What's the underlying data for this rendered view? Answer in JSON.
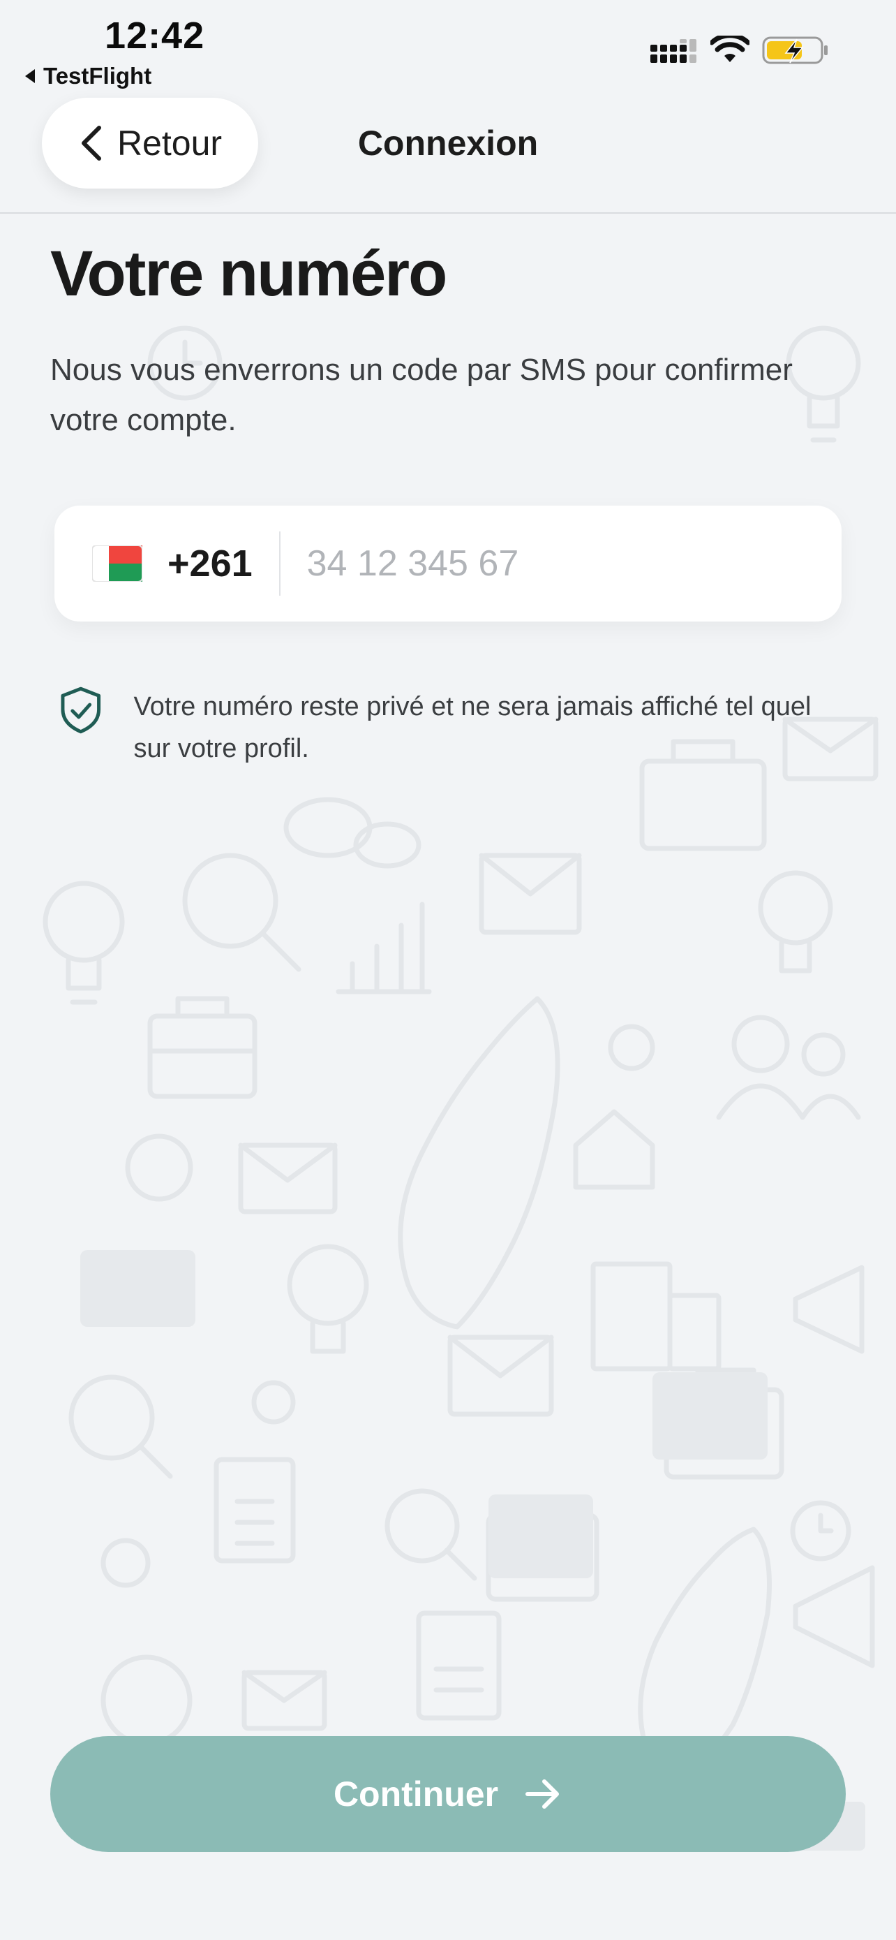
{
  "status_bar": {
    "time": "12:42",
    "back_app": "TestFlight"
  },
  "nav": {
    "back_label": "Retour",
    "title": "Connexion"
  },
  "form": {
    "title": "Votre numéro",
    "subtitle": "Nous vous enverrons un code par SMS pour confirmer votre compte.",
    "dial_code": "+261",
    "country_flag": "madagascar-flag-icon",
    "phone_value": "",
    "phone_placeholder": "34 12 345 67",
    "privacy_note": "Votre numéro reste privé et ne sera jamais affiché tel quel sur votre profil."
  },
  "footer": {
    "continue_label": "Continuer"
  },
  "colors": {
    "background": "#f2f4f6",
    "accent_disabled": "#8bbbb5",
    "shield": "#1f5c54",
    "battery_fill": "#f5c518"
  }
}
